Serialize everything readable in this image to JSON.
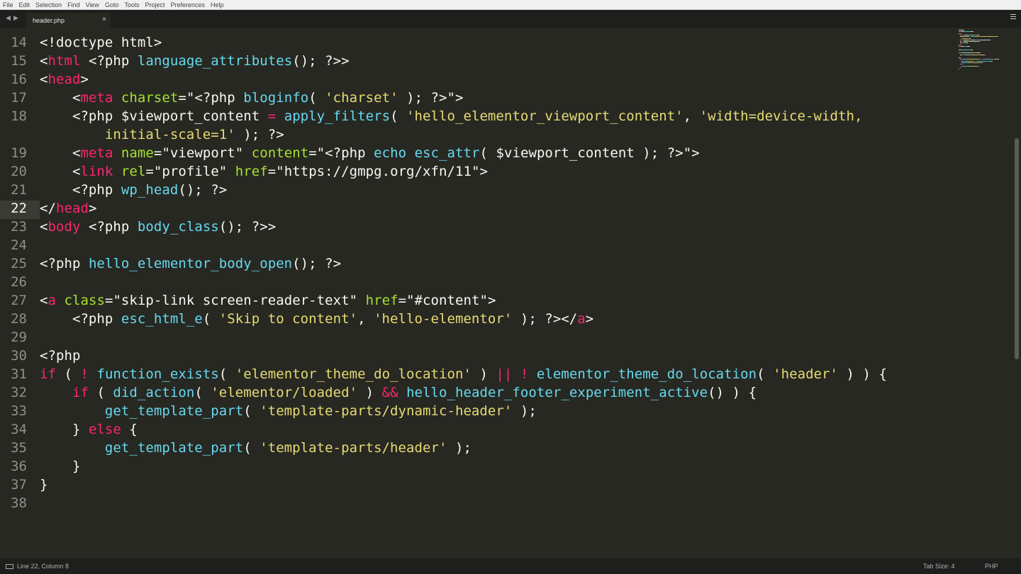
{
  "menu": [
    "File",
    "Edit",
    "Selection",
    "Find",
    "View",
    "Goto",
    "Tools",
    "Project",
    "Preferences",
    "Help"
  ],
  "tabs": [
    {
      "label": "header.php",
      "close": "×"
    }
  ],
  "nav": {
    "back": "◀",
    "forward": "▶"
  },
  "gutter": {
    "active_line": "22"
  },
  "lines": [
    {
      "num": "14",
      "tokens": [
        {
          "t": "txt",
          "v": "<!doctype html>"
        }
      ]
    },
    {
      "num": "15",
      "tokens": [
        {
          "t": "txt",
          "v": "<"
        },
        {
          "t": "tag",
          "v": "html"
        },
        {
          "t": "txt",
          "v": " <?php "
        },
        {
          "t": "fn",
          "v": "language_attributes"
        },
        {
          "t": "txt",
          "v": "(); ?>>"
        }
      ]
    },
    {
      "num": "16",
      "tokens": [
        {
          "t": "txt",
          "v": "<"
        },
        {
          "t": "tag",
          "v": "head"
        },
        {
          "t": "txt",
          "v": ">"
        }
      ]
    },
    {
      "num": "17",
      "tokens": [
        {
          "t": "txt",
          "v": "    <"
        },
        {
          "t": "tag",
          "v": "meta"
        },
        {
          "t": "txt",
          "v": " "
        },
        {
          "t": "attr",
          "v": "charset"
        },
        {
          "t": "txt",
          "v": "=\"<?php "
        },
        {
          "t": "fn",
          "v": "bloginfo"
        },
        {
          "t": "txt",
          "v": "( "
        },
        {
          "t": "str",
          "v": "'charset'"
        },
        {
          "t": "txt",
          "v": " ); ?>\">"
        }
      ]
    },
    {
      "num": "18",
      "tokens": [
        {
          "t": "txt",
          "v": "    <?php $viewport_content "
        },
        {
          "t": "kw",
          "v": "="
        },
        {
          "t": "txt",
          "v": " "
        },
        {
          "t": "fn",
          "v": "apply_filters"
        },
        {
          "t": "txt",
          "v": "( "
        },
        {
          "t": "str",
          "v": "'hello_elementor_viewport_content'"
        },
        {
          "t": "txt",
          "v": ", "
        },
        {
          "t": "str",
          "v": "'width=device-width,"
        }
      ]
    },
    {
      "num": "",
      "tokens": [
        {
          "t": "str",
          "v": "        initial-scale=1'"
        },
        {
          "t": "txt",
          "v": " ); ?>"
        }
      ]
    },
    {
      "num": "19",
      "tokens": [
        {
          "t": "txt",
          "v": "    <"
        },
        {
          "t": "tag",
          "v": "meta"
        },
        {
          "t": "txt",
          "v": " "
        },
        {
          "t": "attr",
          "v": "name"
        },
        {
          "t": "txt",
          "v": "=\"viewport\" "
        },
        {
          "t": "attr",
          "v": "content"
        },
        {
          "t": "txt",
          "v": "=\"<?php "
        },
        {
          "t": "fn",
          "v": "echo"
        },
        {
          "t": "txt",
          "v": " "
        },
        {
          "t": "fn",
          "v": "esc_attr"
        },
        {
          "t": "txt",
          "v": "( $viewport_content ); ?>\">"
        }
      ]
    },
    {
      "num": "20",
      "tokens": [
        {
          "t": "txt",
          "v": "    <"
        },
        {
          "t": "tag",
          "v": "link"
        },
        {
          "t": "txt",
          "v": " "
        },
        {
          "t": "attr",
          "v": "rel"
        },
        {
          "t": "txt",
          "v": "=\"profile\" "
        },
        {
          "t": "attr",
          "v": "href"
        },
        {
          "t": "txt",
          "v": "=\"https://gmpg.org/xfn/11\">"
        }
      ]
    },
    {
      "num": "21",
      "tokens": [
        {
          "t": "txt",
          "v": "    <?php "
        },
        {
          "t": "fn",
          "v": "wp_head"
        },
        {
          "t": "txt",
          "v": "(); ?>"
        }
      ]
    },
    {
      "num": "22",
      "tokens": [
        {
          "t": "txt",
          "v": "</"
        },
        {
          "t": "tag",
          "v": "head"
        },
        {
          "t": "txt",
          "v": ">"
        }
      ]
    },
    {
      "num": "23",
      "tokens": [
        {
          "t": "txt",
          "v": "<"
        },
        {
          "t": "tag",
          "v": "body"
        },
        {
          "t": "txt",
          "v": " <?php "
        },
        {
          "t": "fn",
          "v": "body_class"
        },
        {
          "t": "txt",
          "v": "(); ?>>"
        }
      ]
    },
    {
      "num": "24",
      "tokens": []
    },
    {
      "num": "25",
      "tokens": [
        {
          "t": "txt",
          "v": "<?php "
        },
        {
          "t": "fn",
          "v": "hello_elementor_body_open"
        },
        {
          "t": "txt",
          "v": "(); ?>"
        }
      ]
    },
    {
      "num": "26",
      "tokens": []
    },
    {
      "num": "27",
      "tokens": [
        {
          "t": "txt",
          "v": "<"
        },
        {
          "t": "tag",
          "v": "a"
        },
        {
          "t": "txt",
          "v": " "
        },
        {
          "t": "attr",
          "v": "class"
        },
        {
          "t": "txt",
          "v": "=\"skip-link screen-reader-text\" "
        },
        {
          "t": "attr",
          "v": "href"
        },
        {
          "t": "txt",
          "v": "=\"#content\">"
        }
      ]
    },
    {
      "num": "28",
      "tokens": [
        {
          "t": "txt",
          "v": "    <?php "
        },
        {
          "t": "fn",
          "v": "esc_html_e"
        },
        {
          "t": "txt",
          "v": "( "
        },
        {
          "t": "str",
          "v": "'Skip to content'"
        },
        {
          "t": "txt",
          "v": ", "
        },
        {
          "t": "str",
          "v": "'hello-elementor'"
        },
        {
          "t": "txt",
          "v": " ); ?></"
        },
        {
          "t": "tag",
          "v": "a"
        },
        {
          "t": "txt",
          "v": ">"
        }
      ]
    },
    {
      "num": "29",
      "tokens": []
    },
    {
      "num": "30",
      "tokens": [
        {
          "t": "txt",
          "v": "<?php"
        }
      ]
    },
    {
      "num": "31",
      "tokens": [
        {
          "t": "kw",
          "v": "if"
        },
        {
          "t": "txt",
          "v": " ( "
        },
        {
          "t": "kw",
          "v": "!"
        },
        {
          "t": "txt",
          "v": " "
        },
        {
          "t": "fn",
          "v": "function_exists"
        },
        {
          "t": "txt",
          "v": "( "
        },
        {
          "t": "str",
          "v": "'elementor_theme_do_location'"
        },
        {
          "t": "txt",
          "v": " ) "
        },
        {
          "t": "kw",
          "v": "||"
        },
        {
          "t": "txt",
          "v": " "
        },
        {
          "t": "kw",
          "v": "!"
        },
        {
          "t": "txt",
          "v": " "
        },
        {
          "t": "fn",
          "v": "elementor_theme_do_location"
        },
        {
          "t": "txt",
          "v": "( "
        },
        {
          "t": "str",
          "v": "'header'"
        },
        {
          "t": "txt",
          "v": " ) ) {"
        }
      ]
    },
    {
      "num": "32",
      "tokens": [
        {
          "t": "txt",
          "v": "    "
        },
        {
          "t": "kw",
          "v": "if"
        },
        {
          "t": "txt",
          "v": " ( "
        },
        {
          "t": "fn",
          "v": "did_action"
        },
        {
          "t": "txt",
          "v": "( "
        },
        {
          "t": "str",
          "v": "'elementor/loaded'"
        },
        {
          "t": "txt",
          "v": " ) "
        },
        {
          "t": "kw",
          "v": "&&"
        },
        {
          "t": "txt",
          "v": " "
        },
        {
          "t": "fn",
          "v": "hello_header_footer_experiment_active"
        },
        {
          "t": "txt",
          "v": "() ) {"
        }
      ]
    },
    {
      "num": "33",
      "tokens": [
        {
          "t": "txt",
          "v": "        "
        },
        {
          "t": "fn",
          "v": "get_template_part"
        },
        {
          "t": "txt",
          "v": "( "
        },
        {
          "t": "str",
          "v": "'template-parts/dynamic-header'"
        },
        {
          "t": "txt",
          "v": " );"
        }
      ]
    },
    {
      "num": "34",
      "tokens": [
        {
          "t": "txt",
          "v": "    } "
        },
        {
          "t": "kw",
          "v": "else"
        },
        {
          "t": "txt",
          "v": " {"
        }
      ]
    },
    {
      "num": "35",
      "tokens": [
        {
          "t": "txt",
          "v": "        "
        },
        {
          "t": "fn",
          "v": "get_template_part"
        },
        {
          "t": "txt",
          "v": "( "
        },
        {
          "t": "str",
          "v": "'template-parts/header'"
        },
        {
          "t": "txt",
          "v": " );"
        }
      ]
    },
    {
      "num": "36",
      "tokens": [
        {
          "t": "txt",
          "v": "    }"
        }
      ]
    },
    {
      "num": "37",
      "tokens": [
        {
          "t": "txt",
          "v": "}"
        }
      ]
    },
    {
      "num": "38",
      "tokens": []
    }
  ],
  "colors": {
    "background": "#272822",
    "foreground": "#f8f8f2",
    "tag": "#f92672",
    "attr": "#a6e22e",
    "string": "#e6db74",
    "function": "#66d9ef",
    "keyword": "#f92672",
    "gutter": "#90908a"
  },
  "status": {
    "position": "Line 22, Column 8",
    "tab_size": "Tab Size: 4",
    "syntax": "PHP"
  },
  "icons": {
    "panel_menu": "hamburger-icon",
    "console": "console-icon",
    "close": "close-icon"
  }
}
